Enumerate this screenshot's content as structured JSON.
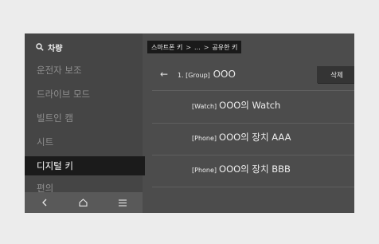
{
  "sidebar": {
    "search_label": "차량",
    "items": [
      {
        "label": "운전자 보조"
      },
      {
        "label": "드라이브 모드"
      },
      {
        "label": "빌트인 캠"
      },
      {
        "label": "시트"
      },
      {
        "label": "디지털 키"
      },
      {
        "label": "편의"
      }
    ]
  },
  "breadcrumb": {
    "items": [
      "스마트폰 키",
      "...",
      "공유한 키"
    ]
  },
  "header": {
    "group_prefix": "1. [Group]",
    "group_name": "OOO",
    "delete_label": "삭제"
  },
  "devices": [
    {
      "tag": "[Watch]",
      "name": "OOO의 Watch"
    },
    {
      "tag": "[Phone]",
      "name": "OOO의 장치 AAA"
    },
    {
      "tag": "[Phone]",
      "name": "OOO의 장치 BBB"
    }
  ]
}
